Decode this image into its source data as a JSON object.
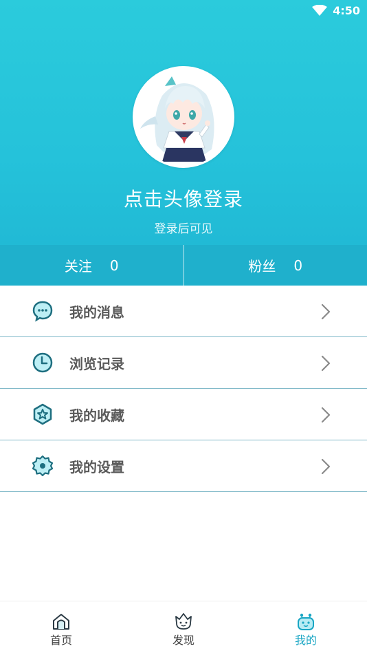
{
  "status_bar": {
    "time": "4:50"
  },
  "profile": {
    "login_prompt": "点击头像登录",
    "login_hint": "登录后可见"
  },
  "stats": [
    {
      "label": "关注",
      "count": "0"
    },
    {
      "label": "粉丝",
      "count": "0"
    }
  ],
  "menu": [
    {
      "label": "我的消息",
      "icon": "message-bubble-icon"
    },
    {
      "label": "浏览记录",
      "icon": "clock-icon"
    },
    {
      "label": "我的收藏",
      "icon": "star-hexagon-icon"
    },
    {
      "label": "我的设置",
      "icon": "settings-gear-icon"
    }
  ],
  "tabs": [
    {
      "label": "首页",
      "icon": "home-icon",
      "active": false
    },
    {
      "label": "发现",
      "icon": "discover-face-icon",
      "active": false
    },
    {
      "label": "我的",
      "icon": "mine-face-icon",
      "active": true
    }
  ],
  "colors": {
    "header": "#25c2da",
    "stats_bar": "#1fb0cc",
    "accent": "#19a6c4",
    "icon_fill": "#bdeff5",
    "icon_stroke": "#1e6f80"
  }
}
